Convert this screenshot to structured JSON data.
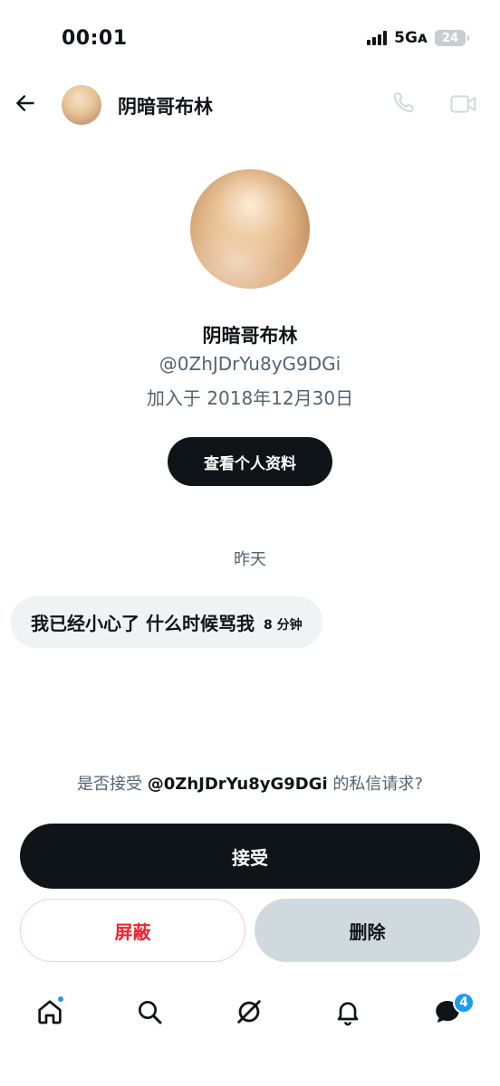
{
  "status_bar": {
    "time": "00:01",
    "network": "5Gᴀ",
    "battery": "24"
  },
  "header": {
    "title": "阴暗哥布林",
    "back_icon": "arrow-left-icon",
    "call_icon": "phone-icon",
    "video_icon": "video-camera-icon"
  },
  "profile": {
    "name": "阴暗哥布林",
    "handle": "@0ZhJDrYu8yG9DGi",
    "joined": "加入于 2018年12月30日",
    "view_profile_label": "查看个人资料"
  },
  "chat": {
    "date_divider": "昨天",
    "messages": [
      {
        "text": "我已经小心了 什么时候骂我",
        "time": "8 分钟"
      }
    ]
  },
  "request": {
    "prompt_prefix": "是否接受 ",
    "prompt_handle": "@0ZhJDrYu8yG9DGi",
    "prompt_suffix": " 的私信请求?",
    "accept_label": "接受",
    "block_label": "屏蔽",
    "delete_label": "删除"
  },
  "bottom_nav": {
    "items": [
      {
        "icon": "home-icon",
        "has_dot": true
      },
      {
        "icon": "search-icon"
      },
      {
        "icon": "grok-icon"
      },
      {
        "icon": "bell-icon"
      },
      {
        "icon": "messages-icon",
        "badge": "4"
      }
    ]
  },
  "colors": {
    "primary_text": "#0f1419",
    "secondary_text": "#536471",
    "accent_blue": "#1d9bf0",
    "danger_red": "#f4212e",
    "bubble_gray": "#eff3f4"
  }
}
